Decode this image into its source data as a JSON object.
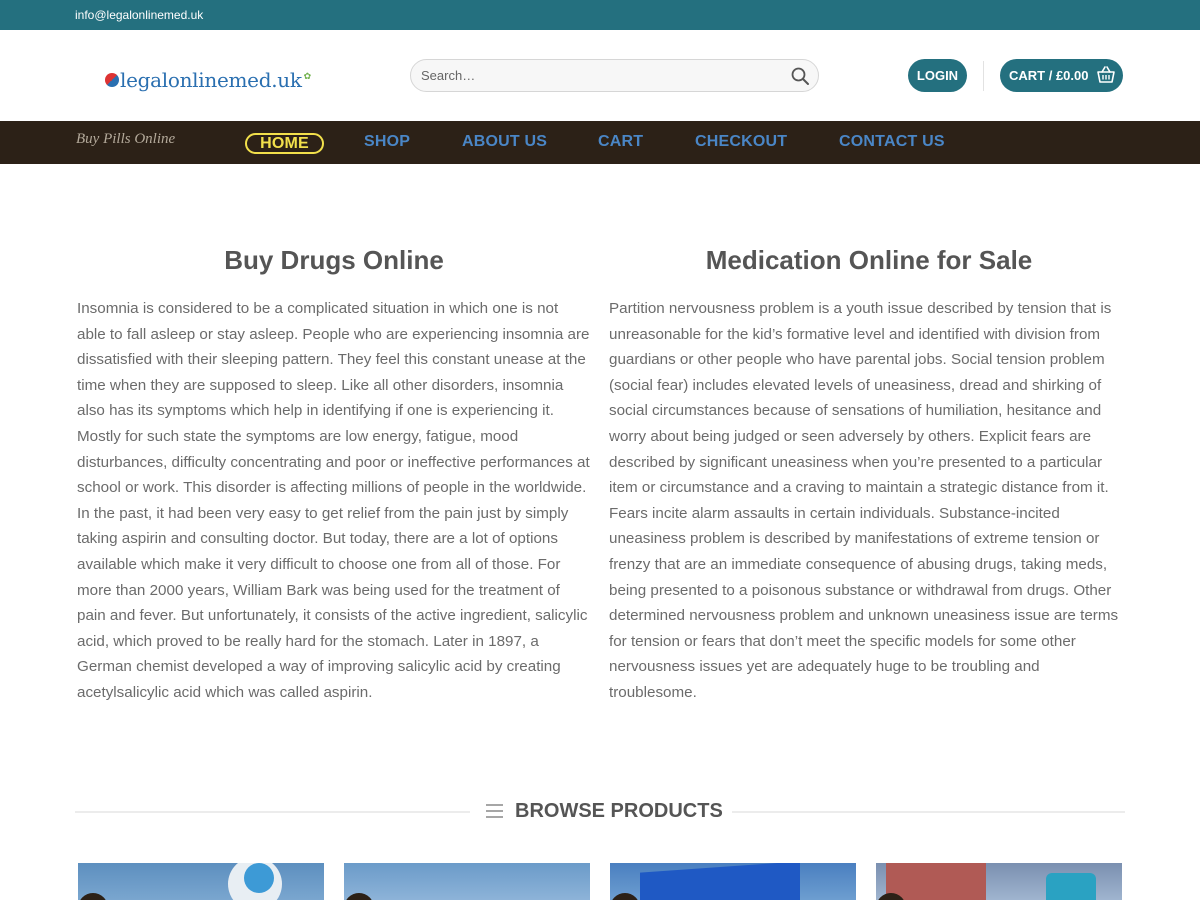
{
  "topbar": {
    "email": "info@legalonlinemed.uk"
  },
  "header": {
    "logo_text": "legalonlinemed.uk",
    "search_placeholder": "Search…",
    "login_label": "LOGIN",
    "cart_label": "CART / £0.00"
  },
  "nav": {
    "tagline": "Buy Pills Online",
    "items": [
      {
        "label": "HOME",
        "active": true
      },
      {
        "label": "SHOP"
      },
      {
        "label": "ABOUT US"
      },
      {
        "label": "CART"
      },
      {
        "label": "CHECKOUT"
      },
      {
        "label": "CONTACT US"
      }
    ]
  },
  "main": {
    "left": {
      "title": "Buy Drugs Online",
      "body": "Insomnia is considered to be a complicated situation in which one is not able to fall asleep or stay asleep. People who are experiencing insomnia are dissatisfied with their sleeping pattern. They feel this constant unease at the time when they are supposed to sleep. Like all other disorders, insomnia also has its symptoms which help in identifying if one is experiencing it. Mostly for such state the symptoms are low energy, fatigue, mood disturbances, difficulty concentrating and poor or ineffective performances at school or work. This disorder is affecting millions of people in the worldwide. In the past, it had been very easy to get relief from the pain just by simply taking aspirin and consulting doctor. But today, there are a lot of options available which make it very difficult to choose one from all of those. For more than 2000 years, William Bark was being used for the treatment of pain and fever. But unfortunately, it consists of the active ingredient, salicylic acid, which proved to be really hard for the stomach. Later in 1897, a German chemist developed a way of improving salicylic acid by creating acetylsalicylic acid which was called aspirin."
    },
    "right": {
      "title": "Medication Online for Sale",
      "body": "Partition nervousness problem is a youth issue described by tension that is unreasonable for the kid’s formative level and identified with division from guardians or other people who have parental jobs. Social tension problem (social fear) includes elevated levels of uneasiness, dread and shirking of social circumstances because of sensations of humiliation, hesitance and worry about being judged or seen adversely by others. Explicit fears are described by significant uneasiness when you’re presented to a particular item or circumstance and a craving to maintain a strategic distance from it. Fears incite alarm assaults in certain individuals. Substance-incited uneasiness problem is described by manifestations of extreme tension or frenzy that are an immediate consequence of abusing drugs, taking meds, being presented to a poisonous substance or withdrawal from drugs. Other determined nervousness problem and unknown uneasiness issue are terms for tension or fears that don’t meet the specific models for some other nervousness issues yet are adequately huge to be troubling and troublesome."
    }
  },
  "browse": {
    "label": "BROWSE PRODUCTS"
  },
  "colors": {
    "brand_teal": "#24707f",
    "nav_bg": "#2c2117",
    "nav_link": "#4a86c6",
    "nav_active": "#f2e04b"
  },
  "icons": [
    "search-icon",
    "basket-icon",
    "menu-icon"
  ]
}
